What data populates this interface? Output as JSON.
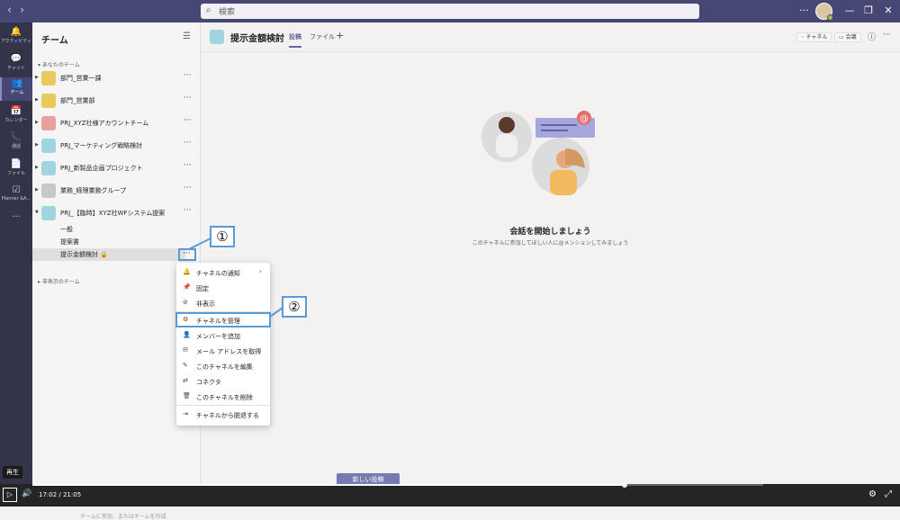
{
  "titlebar": {
    "back": "‹",
    "forward": "›",
    "search_placeholder": "検索",
    "more": "···",
    "minimize": "—",
    "maximize": "❐",
    "close": "✕"
  },
  "rail": [
    {
      "icon": "bell-icon",
      "glyph": "🔔",
      "label": "アクティビティ"
    },
    {
      "icon": "chat-icon",
      "glyph": "💬",
      "label": "チャット"
    },
    {
      "icon": "teams-icon",
      "glyph": "👥",
      "label": "チーム"
    },
    {
      "icon": "calendar-icon",
      "glyph": "📅",
      "label": "カレンダー"
    },
    {
      "icon": "phone-icon",
      "glyph": "📞",
      "label": "通話"
    },
    {
      "icon": "file-icon",
      "glyph": "📄",
      "label": "ファイル"
    },
    {
      "icon": "planner-icon",
      "glyph": "☑",
      "label": "Planner &A..."
    },
    {
      "icon": "more-icon",
      "glyph": "···",
      "label": ""
    }
  ],
  "panel": {
    "title": "チーム",
    "your_teams": "▾ あなたのチーム",
    "hidden_teams": "▸ 非表示のチーム",
    "teams": [
      {
        "name": "部門_営業一課",
        "color": "#e8c95a"
      },
      {
        "name": "部門_営業部",
        "color": "#e8c95a"
      },
      {
        "name": "PRJ_XYZ社様アカウントチーム",
        "color": "#e8a0a0"
      },
      {
        "name": "PRJ_マーケティング戦略検討",
        "color": "#9fd4e0"
      },
      {
        "name": "PRJ_新製品企画プロジェクト",
        "color": "#9fd4e0"
      },
      {
        "name": "業務_経理業務グループ",
        "color": "#c8c8c8"
      },
      {
        "name": "PRJ_【臨時】XYZ社WFシステム提案",
        "color": "#9fd4e0"
      }
    ],
    "channels": [
      "一般",
      "提案書",
      "提示金額検討 🔒"
    ],
    "team_more": "···",
    "bottom_hint": "チームに参加、またはチームを作成"
  },
  "main": {
    "channel_name": "提示金額検討",
    "tabs": [
      "投稿",
      "ファイル"
    ],
    "add_tab": "+",
    "channel_button": "◦ チャネル",
    "meet_button": "▭ 会議",
    "info": "ⓘ",
    "more": "···",
    "empty_title": "会話を開始しましょう",
    "empty_subtitle": "このチャネルに参加してほしい人に@メンションしてみましょう",
    "new_post": "新しい投稿"
  },
  "menu": {
    "items": [
      {
        "icon": "bell-icon",
        "glyph": "🔔",
        "label": "チャネルの通知",
        "submenu": true
      },
      {
        "icon": "pin-icon",
        "glyph": "📌",
        "label": "固定"
      },
      {
        "icon": "eye-off-icon",
        "glyph": "⊘",
        "label": "非表示"
      },
      {
        "icon": "gear-icon",
        "glyph": "⚙",
        "label": "チャネルを管理"
      },
      {
        "icon": "add-member-icon",
        "glyph": "👤",
        "label": "メンバーを追加"
      },
      {
        "icon": "mail-icon",
        "glyph": "✉",
        "label": "メール アドレスを取得"
      },
      {
        "icon": "pencil-icon",
        "glyph": "✎",
        "label": "このチャネルを編集"
      },
      {
        "icon": "connector-icon",
        "glyph": "⇄",
        "label": "コネクタ"
      },
      {
        "icon": "trash-icon",
        "glyph": "🗑",
        "label": "このチャネルを削除"
      },
      {
        "icon": "leave-icon",
        "glyph": "⇥",
        "label": "チャネルから脱退する"
      }
    ],
    "submenu_chevron": "›"
  },
  "callouts": [
    "①",
    "②"
  ],
  "player": {
    "tooltip": "再生",
    "play": "▷",
    "volume": "🔊",
    "time": "17:02 / 21:05",
    "progress": 0.81,
    "settings": "⚙",
    "fullscreen": "⤢"
  }
}
